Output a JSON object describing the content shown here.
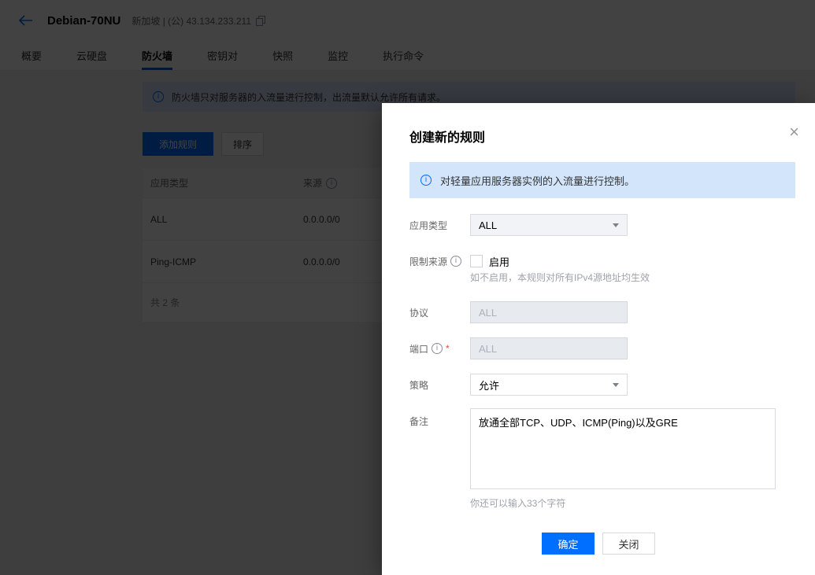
{
  "topbar": {
    "title": "Debian-70NU",
    "meta": "新加坡 | (公) 43.134.233.211"
  },
  "tabs": {
    "items": [
      {
        "label": "概要"
      },
      {
        "label": "云硬盘"
      },
      {
        "label": "防火墙"
      },
      {
        "label": "密钥对"
      },
      {
        "label": "快照"
      },
      {
        "label": "监控"
      },
      {
        "label": "执行命令"
      }
    ],
    "active": "防火墙"
  },
  "firewall_page": {
    "notice": "防火墙只对服务器的入流量进行控制，出流量默认允许所有请求。",
    "add_rule_label": "添加规则",
    "sort_label": "排序",
    "table": {
      "col_app_type": "应用类型",
      "col_source": "来源",
      "rows": [
        {
          "app_type": "ALL",
          "source": "0.0.0.0/0"
        },
        {
          "app_type": "Ping-ICMP",
          "source": "0.0.0.0/0"
        }
      ],
      "footer": "共 2 条"
    }
  },
  "modal": {
    "title": "创建新的规则",
    "notice": "对轻量应用服务器实例的入流量进行控制。",
    "app_type": {
      "label": "应用类型",
      "value": "ALL"
    },
    "limit_source": {
      "label": "限制来源",
      "checkbox_label": "启用",
      "hint": "如不启用，本规则对所有IPv4源地址均生效"
    },
    "protocol": {
      "label": "协议",
      "value": "ALL"
    },
    "port": {
      "label": "端口",
      "required_mark": "*",
      "value": "ALL"
    },
    "policy": {
      "label": "策略",
      "value": "允许"
    },
    "remark": {
      "label": "备注",
      "value": "放通全部TCP、UDP、ICMP(Ping)以及GRE",
      "hint": "你还可以输入33个字符"
    },
    "confirm_label": "确定",
    "close_label": "关闭"
  },
  "colors": {
    "accent": "#006eff",
    "notice_bg": "#d3e5fb"
  }
}
